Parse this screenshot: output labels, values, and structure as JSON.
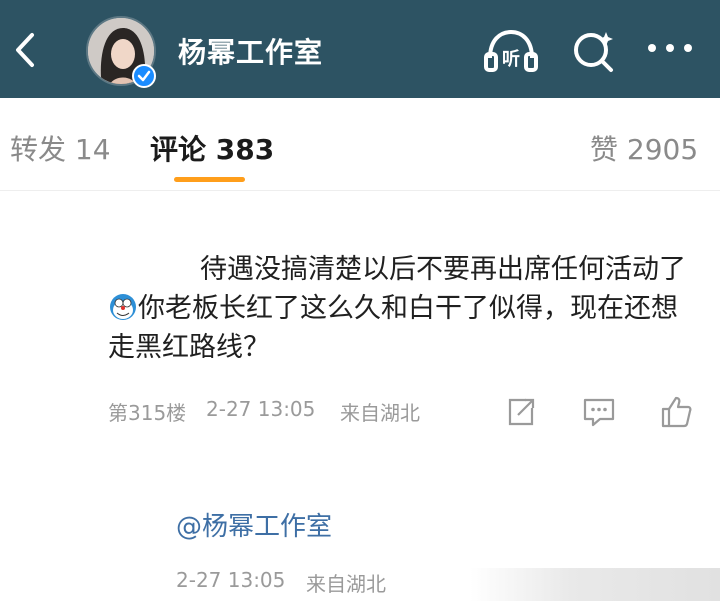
{
  "header": {
    "title": "杨幂工作室",
    "listen_label": "听"
  },
  "tabs": {
    "repost": "转发 14",
    "comments": "评论 383",
    "likes": "赞 2905"
  },
  "comment": {
    "text_part1": "待遇没搞清楚以后不要再出席任何活动了",
    "text_part2": "你老板长红了这么久和白干了似得，现在还想走黑红路线？",
    "floor": "第315楼",
    "time": "2-27 13:05",
    "location": "来自湖北"
  },
  "reply": {
    "mention": "@杨幂工作室",
    "time": "2-27 13:05",
    "location": "来自湖北"
  },
  "colors": {
    "header_bg": "#2d5363",
    "tab_indicator": "#ff9e1b",
    "mention": "#3e6fa5"
  }
}
